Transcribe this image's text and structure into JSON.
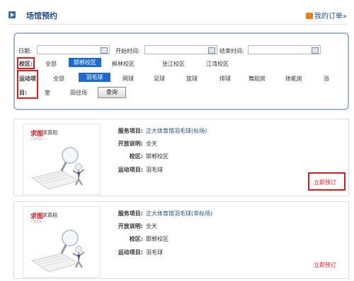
{
  "header": {
    "title": "场馆预约",
    "my_orders": "我的订单»"
  },
  "filter": {
    "date_label": "日期:",
    "start_label": "开始时间:",
    "end_label": "结束时间:",
    "campus_label": "校区:",
    "campus_options": [
      "全部",
      "邯郸校区",
      "枫林校区",
      "张江校区",
      "江湾校区"
    ],
    "campus_selected": "邯郸校区",
    "sport_label_1": "运动项",
    "sport_label_2": "目:",
    "sport_options": [
      "全部",
      "羽毛球",
      "网球",
      "足球",
      "篮球",
      "排球",
      "舞蹈房",
      "体能房",
      "浴",
      "室",
      "田径场"
    ],
    "sport_selected": "羽毛球",
    "search_button": "查询"
  },
  "thumb": {
    "red": "求图",
    "black": "求真相",
    "sub": "点我求图 >..."
  },
  "results": [
    {
      "service_label": "服务项目:",
      "service": "正大体育馆羽毛球(标场)",
      "open_label": "开放说明:",
      "open": "全天",
      "campus_label": "校区:",
      "campus": "邯郸校区",
      "sport_label": "运动项目:",
      "sport": "羽毛球",
      "book": "立即预订"
    },
    {
      "service_label": "服务项目:",
      "service": "正大体育馆羽毛球(非标场)",
      "open_label": "开放说明:",
      "open": "全天",
      "campus_label": "校区:",
      "campus": "邯郸校区",
      "sport_label": "运动项目:",
      "sport": "羽毛球",
      "book": "立即预订"
    }
  ],
  "colors": {
    "accent": "#1a6ad0",
    "highlight": "#e0191e",
    "border": "#9fb6d8"
  }
}
